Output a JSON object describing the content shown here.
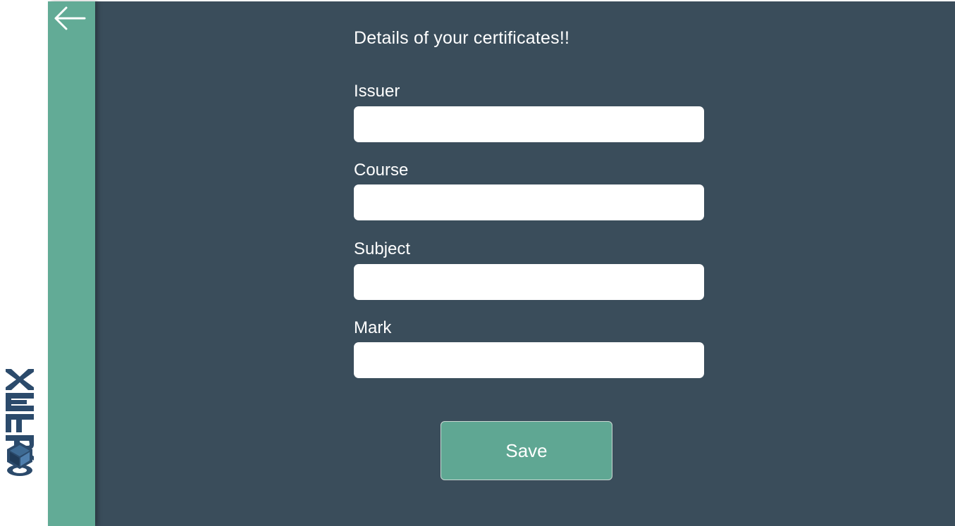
{
  "brand": {
    "logo_text": "CORTEX",
    "logo_color": "#2b4a6b"
  },
  "nav": {
    "back_icon": "arrow-left-icon"
  },
  "form": {
    "title": "Details of your certificates!!",
    "fields": [
      {
        "label": "Issuer",
        "value": "",
        "placeholder": ""
      },
      {
        "label": "Course",
        "value": "",
        "placeholder": ""
      },
      {
        "label": "Subject",
        "value": "",
        "placeholder": ""
      },
      {
        "label": "Mark",
        "value": "",
        "placeholder": ""
      }
    ],
    "save_label": "Save"
  },
  "colors": {
    "rail": "#62ab96",
    "panel": "#3a4d5b",
    "button": "#5fa793",
    "text": "#ffffff"
  }
}
